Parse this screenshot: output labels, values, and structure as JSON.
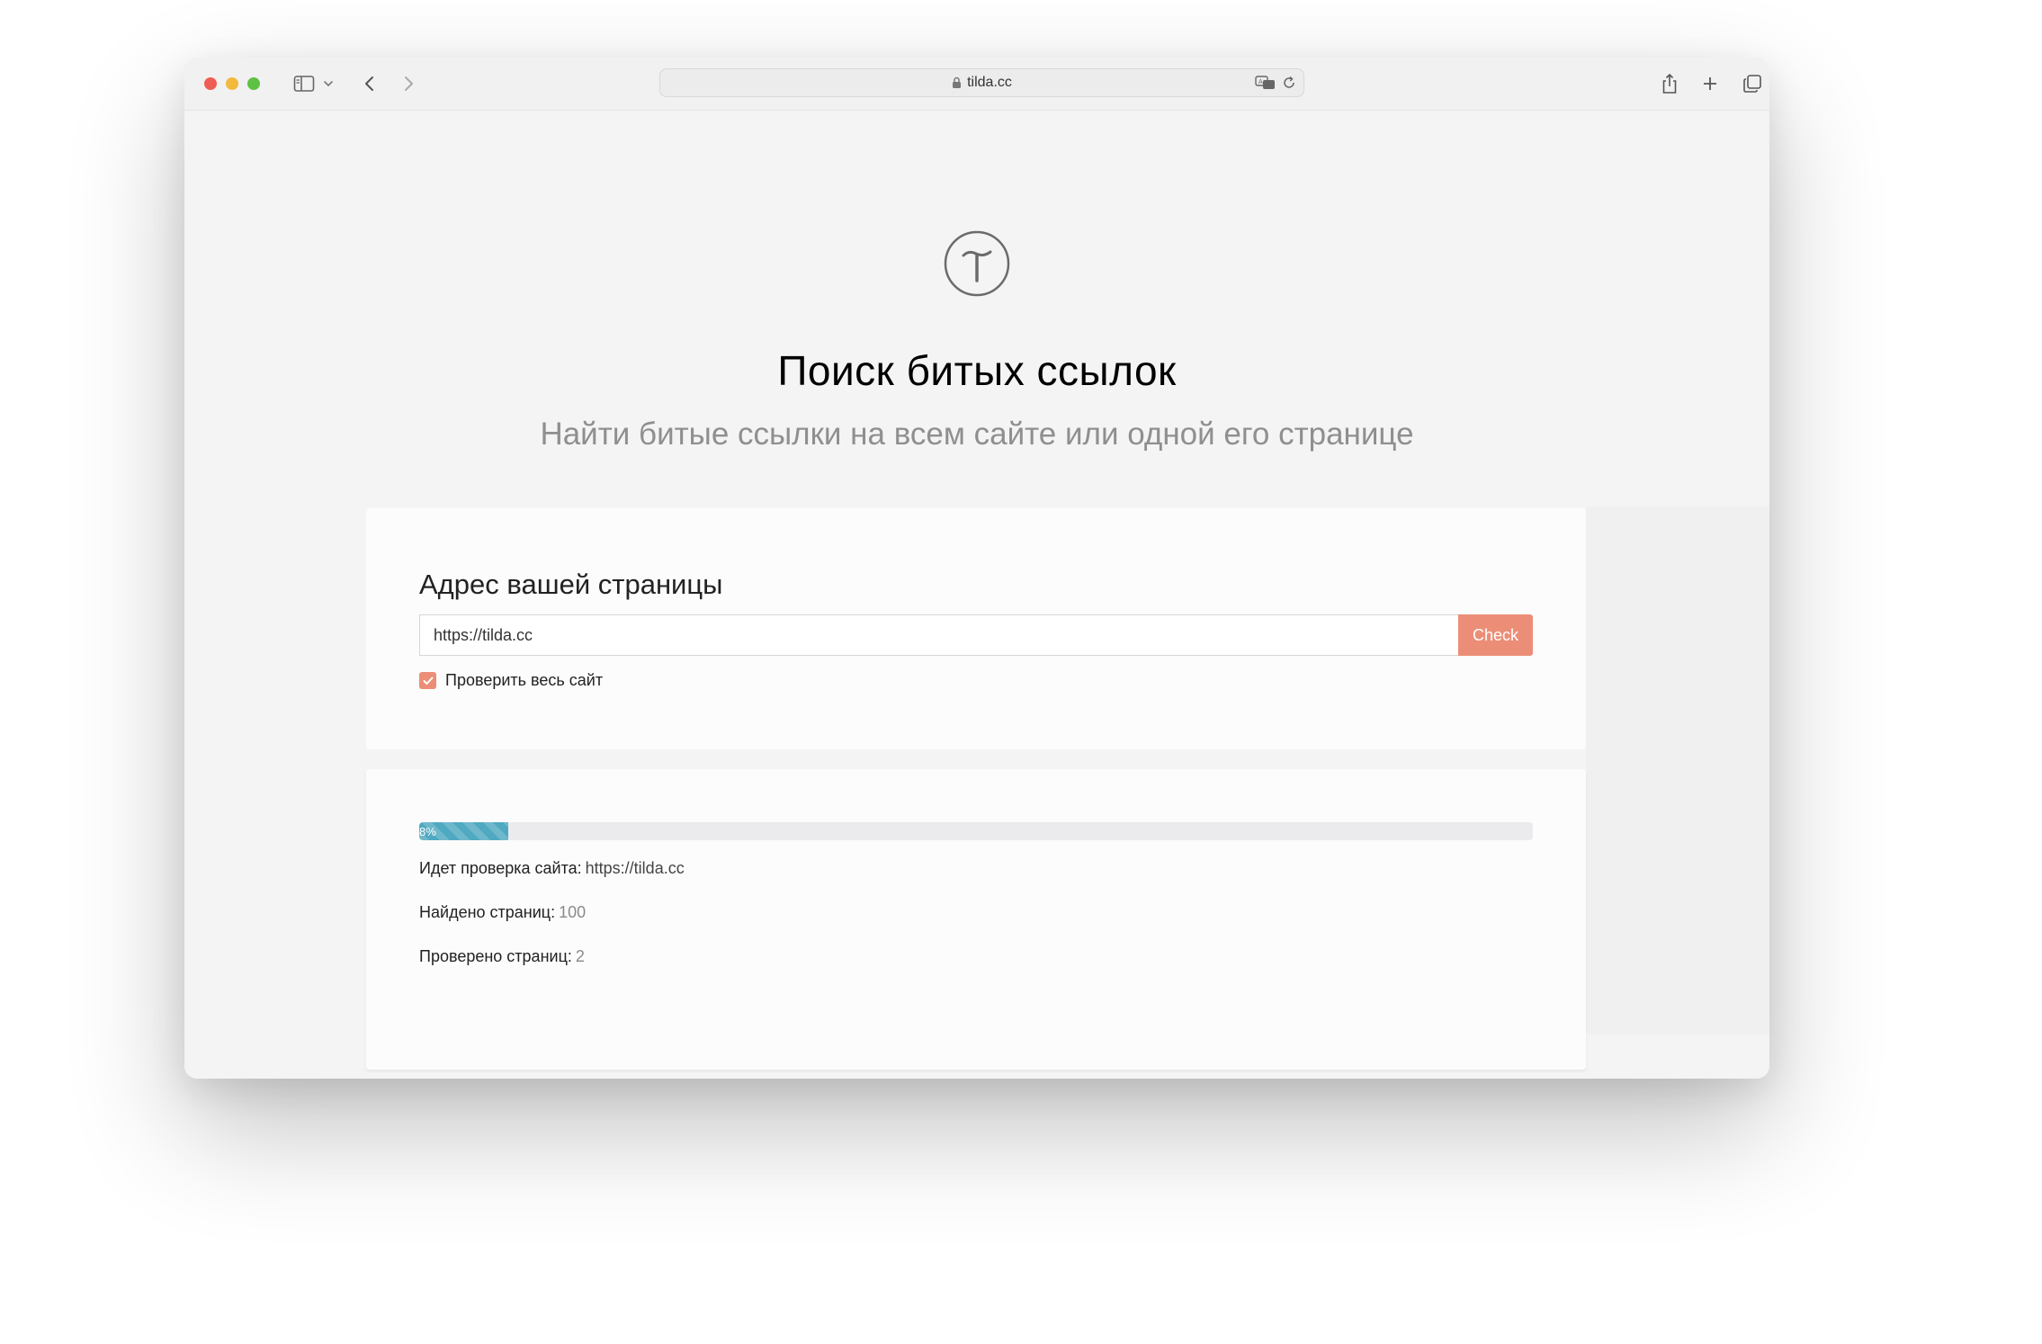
{
  "browser": {
    "url": "tilda.cc",
    "colors": {
      "close": "#ee5e56",
      "minimize": "#f2b93c",
      "maximize": "#5ec143"
    }
  },
  "page": {
    "title": "Поиск битых ссылок",
    "subtitle": "Найти битые ссылки на всем сайте или одной его странице"
  },
  "form": {
    "heading": "Адрес вашей страницы",
    "url_value": "https://tilda.cc",
    "check_label": "Check",
    "whole_site_label": "Проверить весь сайт",
    "whole_site_checked": true,
    "accent_color": "#ec8e77"
  },
  "progress": {
    "percent": 8,
    "label": "8%",
    "color": "#4fa9c1",
    "checking_label": "Идет проверка сайта:",
    "checking_url": "https://tilda.cc",
    "found_label": "Найдено страниц:",
    "found_value": "100",
    "checked_label": "Проверено страниц:",
    "checked_value": "2"
  },
  "icons": [
    "sidebar-icon",
    "chevron-down-icon",
    "back-icon",
    "forward-icon",
    "lock-icon",
    "translate-icon",
    "reload-icon",
    "share-icon",
    "new-tab-icon",
    "tabs-overview-icon",
    "tilda-logo-icon",
    "checkmark-icon"
  ]
}
